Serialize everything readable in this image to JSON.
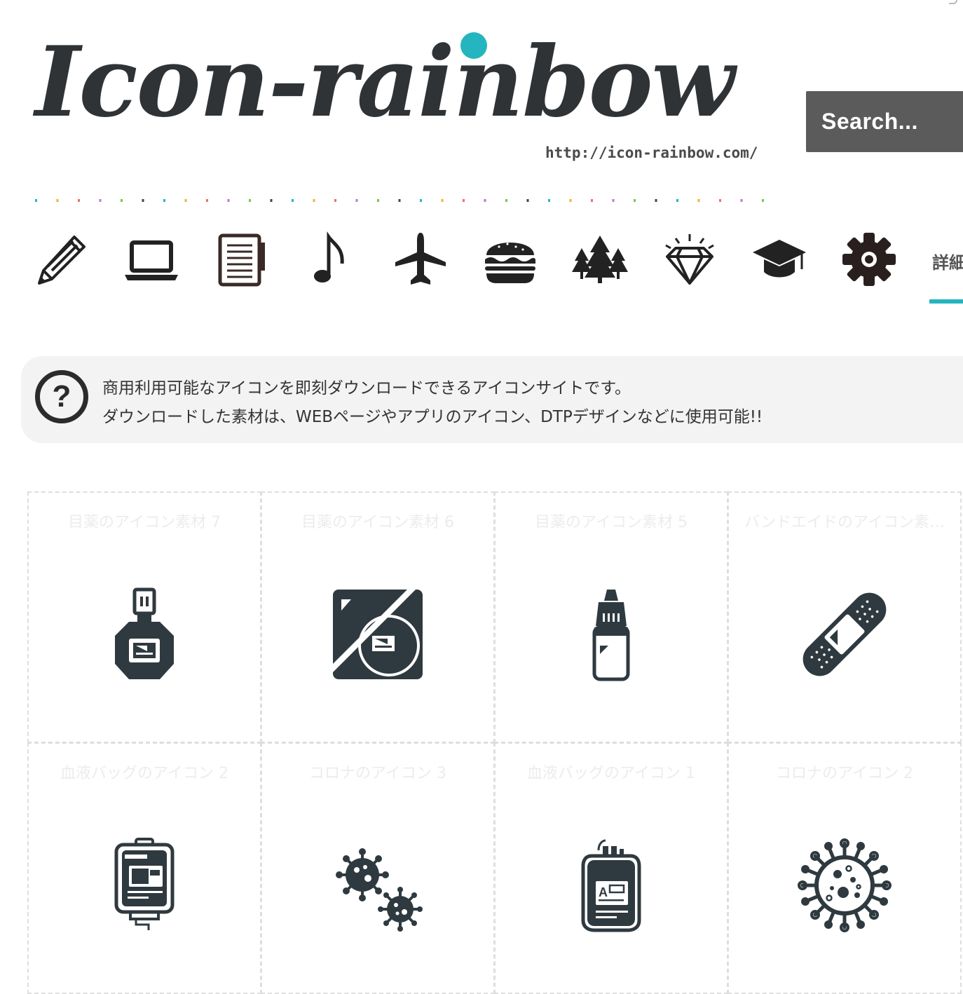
{
  "header": {
    "logo_text": "Icon-rainbow",
    "logo_url": "http://icon-rainbow.com/",
    "search_placeholder": "Search..."
  },
  "nav": {
    "icons": [
      "pencil-icon",
      "laptop-icon",
      "notebook-icon",
      "music-note-icon",
      "airplane-icon",
      "hamburger-icon",
      "trees-icon",
      "diamond-icon",
      "graduation-cap-icon",
      "gear-icon"
    ],
    "detail_label": "詳細"
  },
  "intro": {
    "icon": "question-icon",
    "line1": "商用利用可能なアイコンを即刻ダウンロードできるアイコンサイトです。",
    "line2": "ダウンロードした素材は、WEBページやアプリのアイコン、DTPデザインなどに使用可能!!"
  },
  "grid": {
    "items": [
      {
        "title": "目薬のアイコン素材 7",
        "icon": "eye-drops-icon"
      },
      {
        "title": "目薬のアイコン素材 6",
        "icon": "eye-drops-package-icon"
      },
      {
        "title": "目薬のアイコン素材 5",
        "icon": "eye-drops-bottle-icon"
      },
      {
        "title": "バンドエイドのアイコン素…",
        "icon": "bandage-icon"
      },
      {
        "title": "血液バッグのアイコン 2",
        "icon": "blood-bag-icon"
      },
      {
        "title": "コロナのアイコン 3",
        "icon": "virus-icon"
      },
      {
        "title": "血液バッグのアイコン 1",
        "icon": "blood-bag-icon"
      },
      {
        "title": "コロナのアイコン 2",
        "icon": "virus-outline-icon"
      }
    ]
  },
  "colors": {
    "accent": "#25b5bf",
    "icon_dark": "#2f3a40",
    "search_bg": "#5b5b5b",
    "intro_bg": "#f3f3f3"
  }
}
